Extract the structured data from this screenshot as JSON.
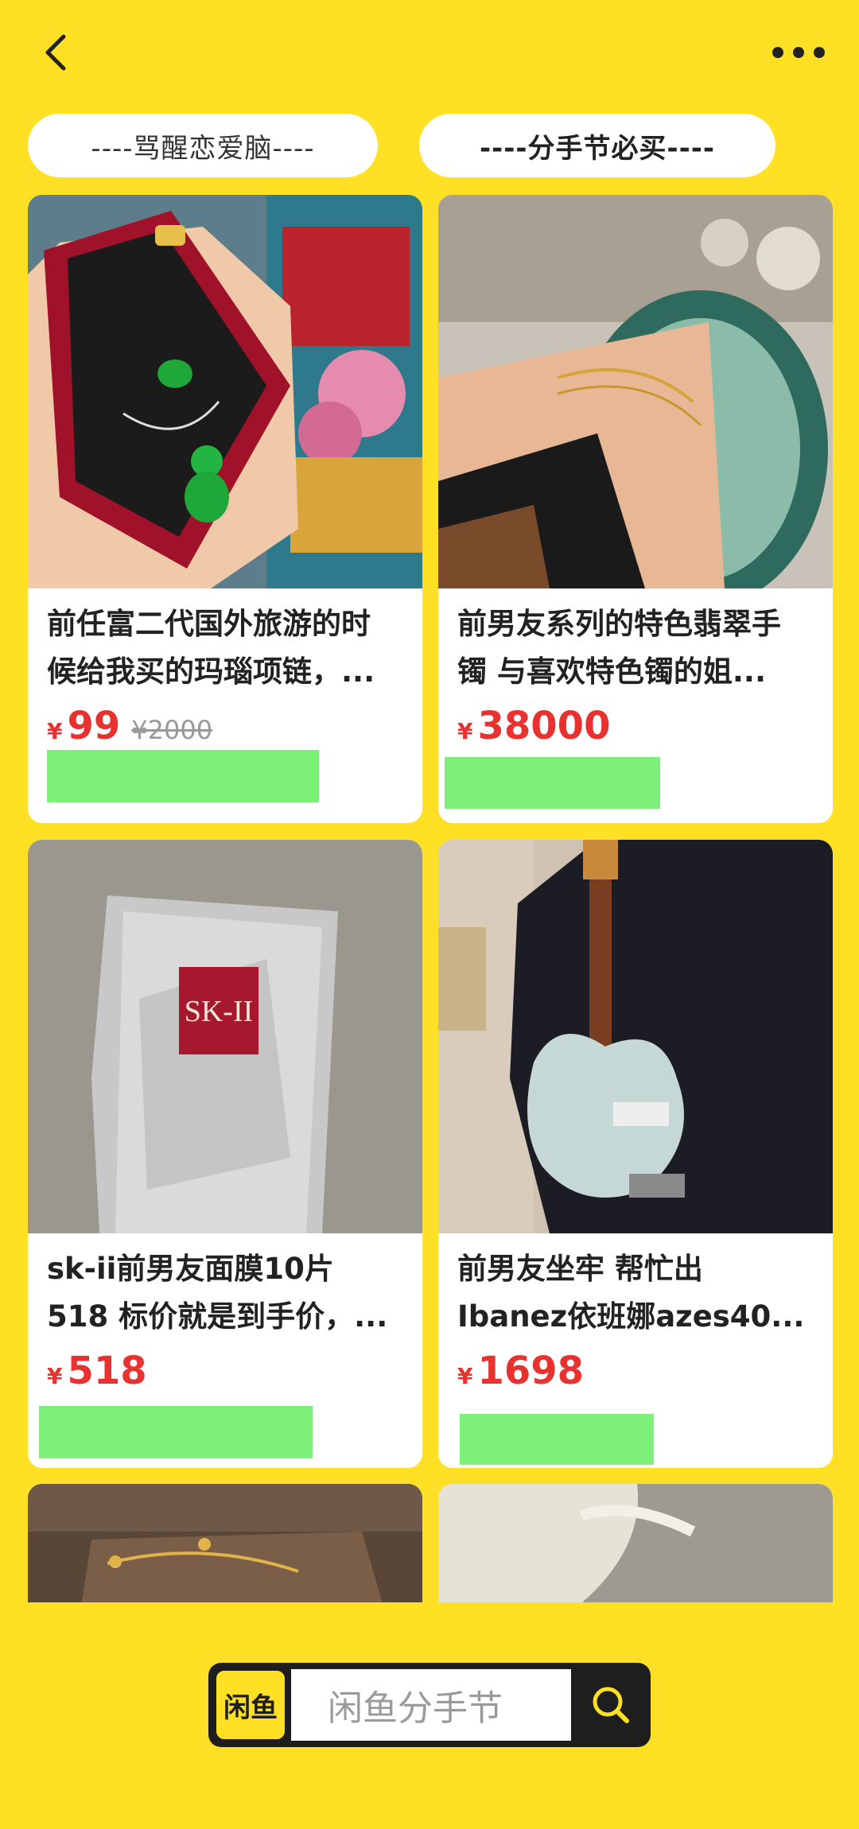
{
  "header": {
    "tags": [
      "----骂醒恋爱脑----",
      "----分手节必买----"
    ]
  },
  "products": [
    {
      "title": "前任富二代国外旅游的时\n候给我买的玛瑙项链，...",
      "yen": "¥",
      "price": "99",
      "original_price": "¥2000",
      "image": "jade-necklace-photo"
    },
    {
      "title": "前男友系列的特色翡翠手\n镯 与喜欢特色镯的姐...",
      "yen": "¥",
      "price": "38000",
      "original_price": "",
      "image": "jade-bangle-photo"
    },
    {
      "title": "sk-ii前男友面膜10片\n518 标价就是到手价，...",
      "yen": "¥",
      "price": "518",
      "original_price": "",
      "image": "face-mask-photo"
    },
    {
      "title": "前男友坐牢 帮忙出\nIbanez依班娜azes40...",
      "yen": "¥",
      "price": "1698",
      "original_price": "",
      "image": "electric-guitar-photo"
    }
  ],
  "search": {
    "logo_text": "闲鱼",
    "placeholder": "闲鱼分手节"
  },
  "colors": {
    "background": "#ffe024",
    "price": "#e8322f",
    "redaction": "#7df07a"
  }
}
